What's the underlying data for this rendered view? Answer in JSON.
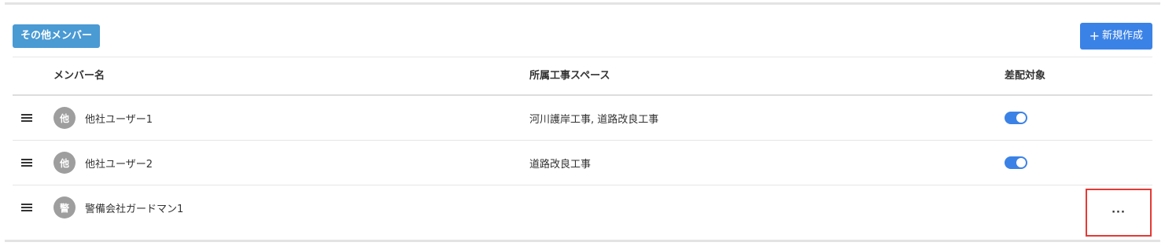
{
  "section": {
    "title": "その他メンバー",
    "new_button_label": "新規作成",
    "new_button_icon": "plus-icon"
  },
  "table": {
    "headers": {
      "member_name": "メンバー名",
      "workspace": "所属工事スペース",
      "dispatch": "差配対象"
    },
    "rows": [
      {
        "avatar": "他",
        "name": "他社ユーザー1",
        "workspace": "河川護岸工事, 道路改良工事",
        "dispatch_enabled": true
      },
      {
        "avatar": "他",
        "name": "他社ユーザー2",
        "workspace": "道路改良工事",
        "dispatch_enabled": true
      },
      {
        "avatar": "警",
        "name": "警備会社ガードマン1",
        "workspace": "",
        "dispatch_enabled": null,
        "action_label": "···"
      }
    ]
  },
  "colors": {
    "badge": "#4a9ad4",
    "primary": "#3b82e6",
    "avatar": "#9e9e9e",
    "highlight": "#e53935"
  }
}
